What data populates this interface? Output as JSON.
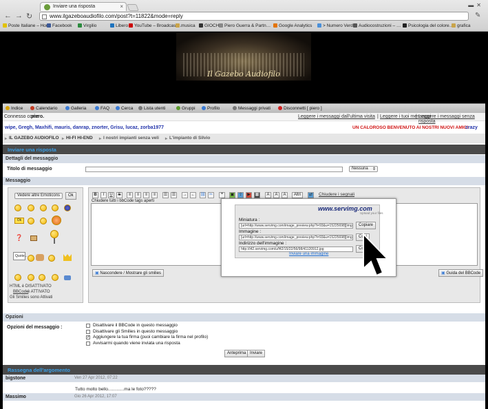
{
  "browser": {
    "tab_title": "Inviare una risposta",
    "url": "www.ilgazeboaudiofilo.com/post?t=11822&mode=reply",
    "bookmarks": [
      {
        "label": "Poste Italiane – Hom",
        "color": "#e2c200"
      },
      {
        "label": "Facebook",
        "color": "#3b5998"
      },
      {
        "label": "Virgilio",
        "color": "#2b8a3e"
      },
      {
        "label": "Libero",
        "color": "#1e73be"
      },
      {
        "label": "YouTube – Broadcast…",
        "color": "#cc0000"
      },
      {
        "label": "musica",
        "color": "#c9a44a"
      },
      {
        "label": "GIOCHI",
        "color": "#333333"
      },
      {
        "label": "Piero Guerra & Partn…",
        "color": "#888888"
      },
      {
        "label": "Google Analytics",
        "color": "#e37400"
      },
      {
        "label": "> Numero Verde",
        "color": "#4a90d9"
      },
      {
        "label": "Audiocostruzioni – …",
        "color": "#555555"
      },
      {
        "label": "Psicologia del colore…",
        "color": "#222222"
      },
      {
        "label": "grafica",
        "color": "#c9a44a"
      }
    ]
  },
  "banner": {
    "title": "Il Gazebo Audiofilo"
  },
  "menu": [
    {
      "label": "Indice",
      "color": "#d9a300"
    },
    {
      "label": "Calendario",
      "color": "#c23b22"
    },
    {
      "label": "Galleria",
      "color": "#3a7bd5"
    },
    {
      "label": "FAQ",
      "color": "#3a7bd5"
    },
    {
      "label": "Cerca",
      "color": "#3a7bd5"
    },
    {
      "label": "Lista utenti",
      "color": "#777777"
    },
    {
      "label": "Gruppi",
      "color": "#5a9a2a"
    },
    {
      "label": "Profilo",
      "color": "#3a7bd5"
    },
    {
      "label": "Messaggi privati",
      "color": "#777777"
    },
    {
      "label": "Disconnetti [ piero ]",
      "color": "#d21f1f"
    }
  ],
  "connection": {
    "prefix": "Connesso come",
    "user": "piero.",
    "links": [
      "Leggere i messaggi dall'ultima visita",
      "Leggere i tuoi messaggi",
      "Leggere i messaggi senza risposta"
    ]
  },
  "online_users": "wipe, Gregh, Maxhifi, mauris, danrap, znorter, Grisu, lucaz, zorba1977",
  "welcome": "UN CALOROSO BENVENUTO AI NOSTRI NUOVI AMICI:",
  "welcome_name": "crazy",
  "breadcrumb": [
    "IL GAZEBO AUDIOFILO",
    "HI-FI HI-END",
    "I nostri impianti senza veli",
    "L'impianto di Silvio"
  ],
  "form": {
    "header": "Inviare una risposta",
    "details_header": "Dettagli del messaggio",
    "title_label": "Titolo di messaggio",
    "title_value": "",
    "title_select": "Nessuna",
    "message_label": "Messaggio",
    "emoticon_select": "Vedere altre Emoticons",
    "emoticon_ok": "Ok",
    "quote_bubble": "Quote...",
    "html_status": "HTML è DISATTIVATO",
    "bbcode_link": "BBCode",
    "bbcode_status": "è ATTIVATO",
    "smilies_status": "Gli Smilies sono Attivati",
    "toolbar_altri": "Altri",
    "toolbar_close_tags": "Chiudere i segnali",
    "close_all_tags": "Chiudere tutti i bbCode tags aperti",
    "hide_smilies": "Nascondere / Mostrare gli smilies",
    "bbcode_guide": "Guida del BBCode"
  },
  "popup": {
    "brand": "www.servimg.com",
    "brand_sub": "Upload your files",
    "thumb_label": "Miniatura :",
    "thumb_value": "[url=http://www.servimg.com/image_preview.php?i=93&u=15225698][img",
    "image_label": "Immagine :",
    "image_value": "[url=http://www.servimg.com/image_preview.php?i=93&u=15225698][img",
    "address_label": "Indirizzo dell'immagine :",
    "address_value": "http://i42.servimg.com/u/f42/15/22/56/98/41120912.jpg",
    "copy_label": "Copiare",
    "copy_label_2": "Copi",
    "upload_link": "Inviare una immagine"
  },
  "options": {
    "header": "Opzioni",
    "label": "Opzioni del messaggio :",
    "items": [
      {
        "label": "Disattivare il BBCode in questo messaggio",
        "checked": false
      },
      {
        "label": "Disattivare gli Smilies in questo messaggio",
        "checked": false
      },
      {
        "label": "Aggiungere la tua firma (puoi cambiare la firma nel profilo)",
        "checked": true
      },
      {
        "label": "Avvisarmi quando viene inviata una risposta",
        "checked": false
      }
    ],
    "preview_button": "Anteprima",
    "send_button": "Inviare"
  },
  "review": {
    "header": "Rassegna dell'argomento",
    "posts": [
      {
        "author": "bigstone",
        "date": "Ven 27 Apr 2012, 07:22",
        "text": "Tutto molto bello.............ma le foto?????"
      },
      {
        "author": "Massimo",
        "date": "Gio 26 Apr 2012, 17:07",
        "text": ""
      }
    ]
  }
}
